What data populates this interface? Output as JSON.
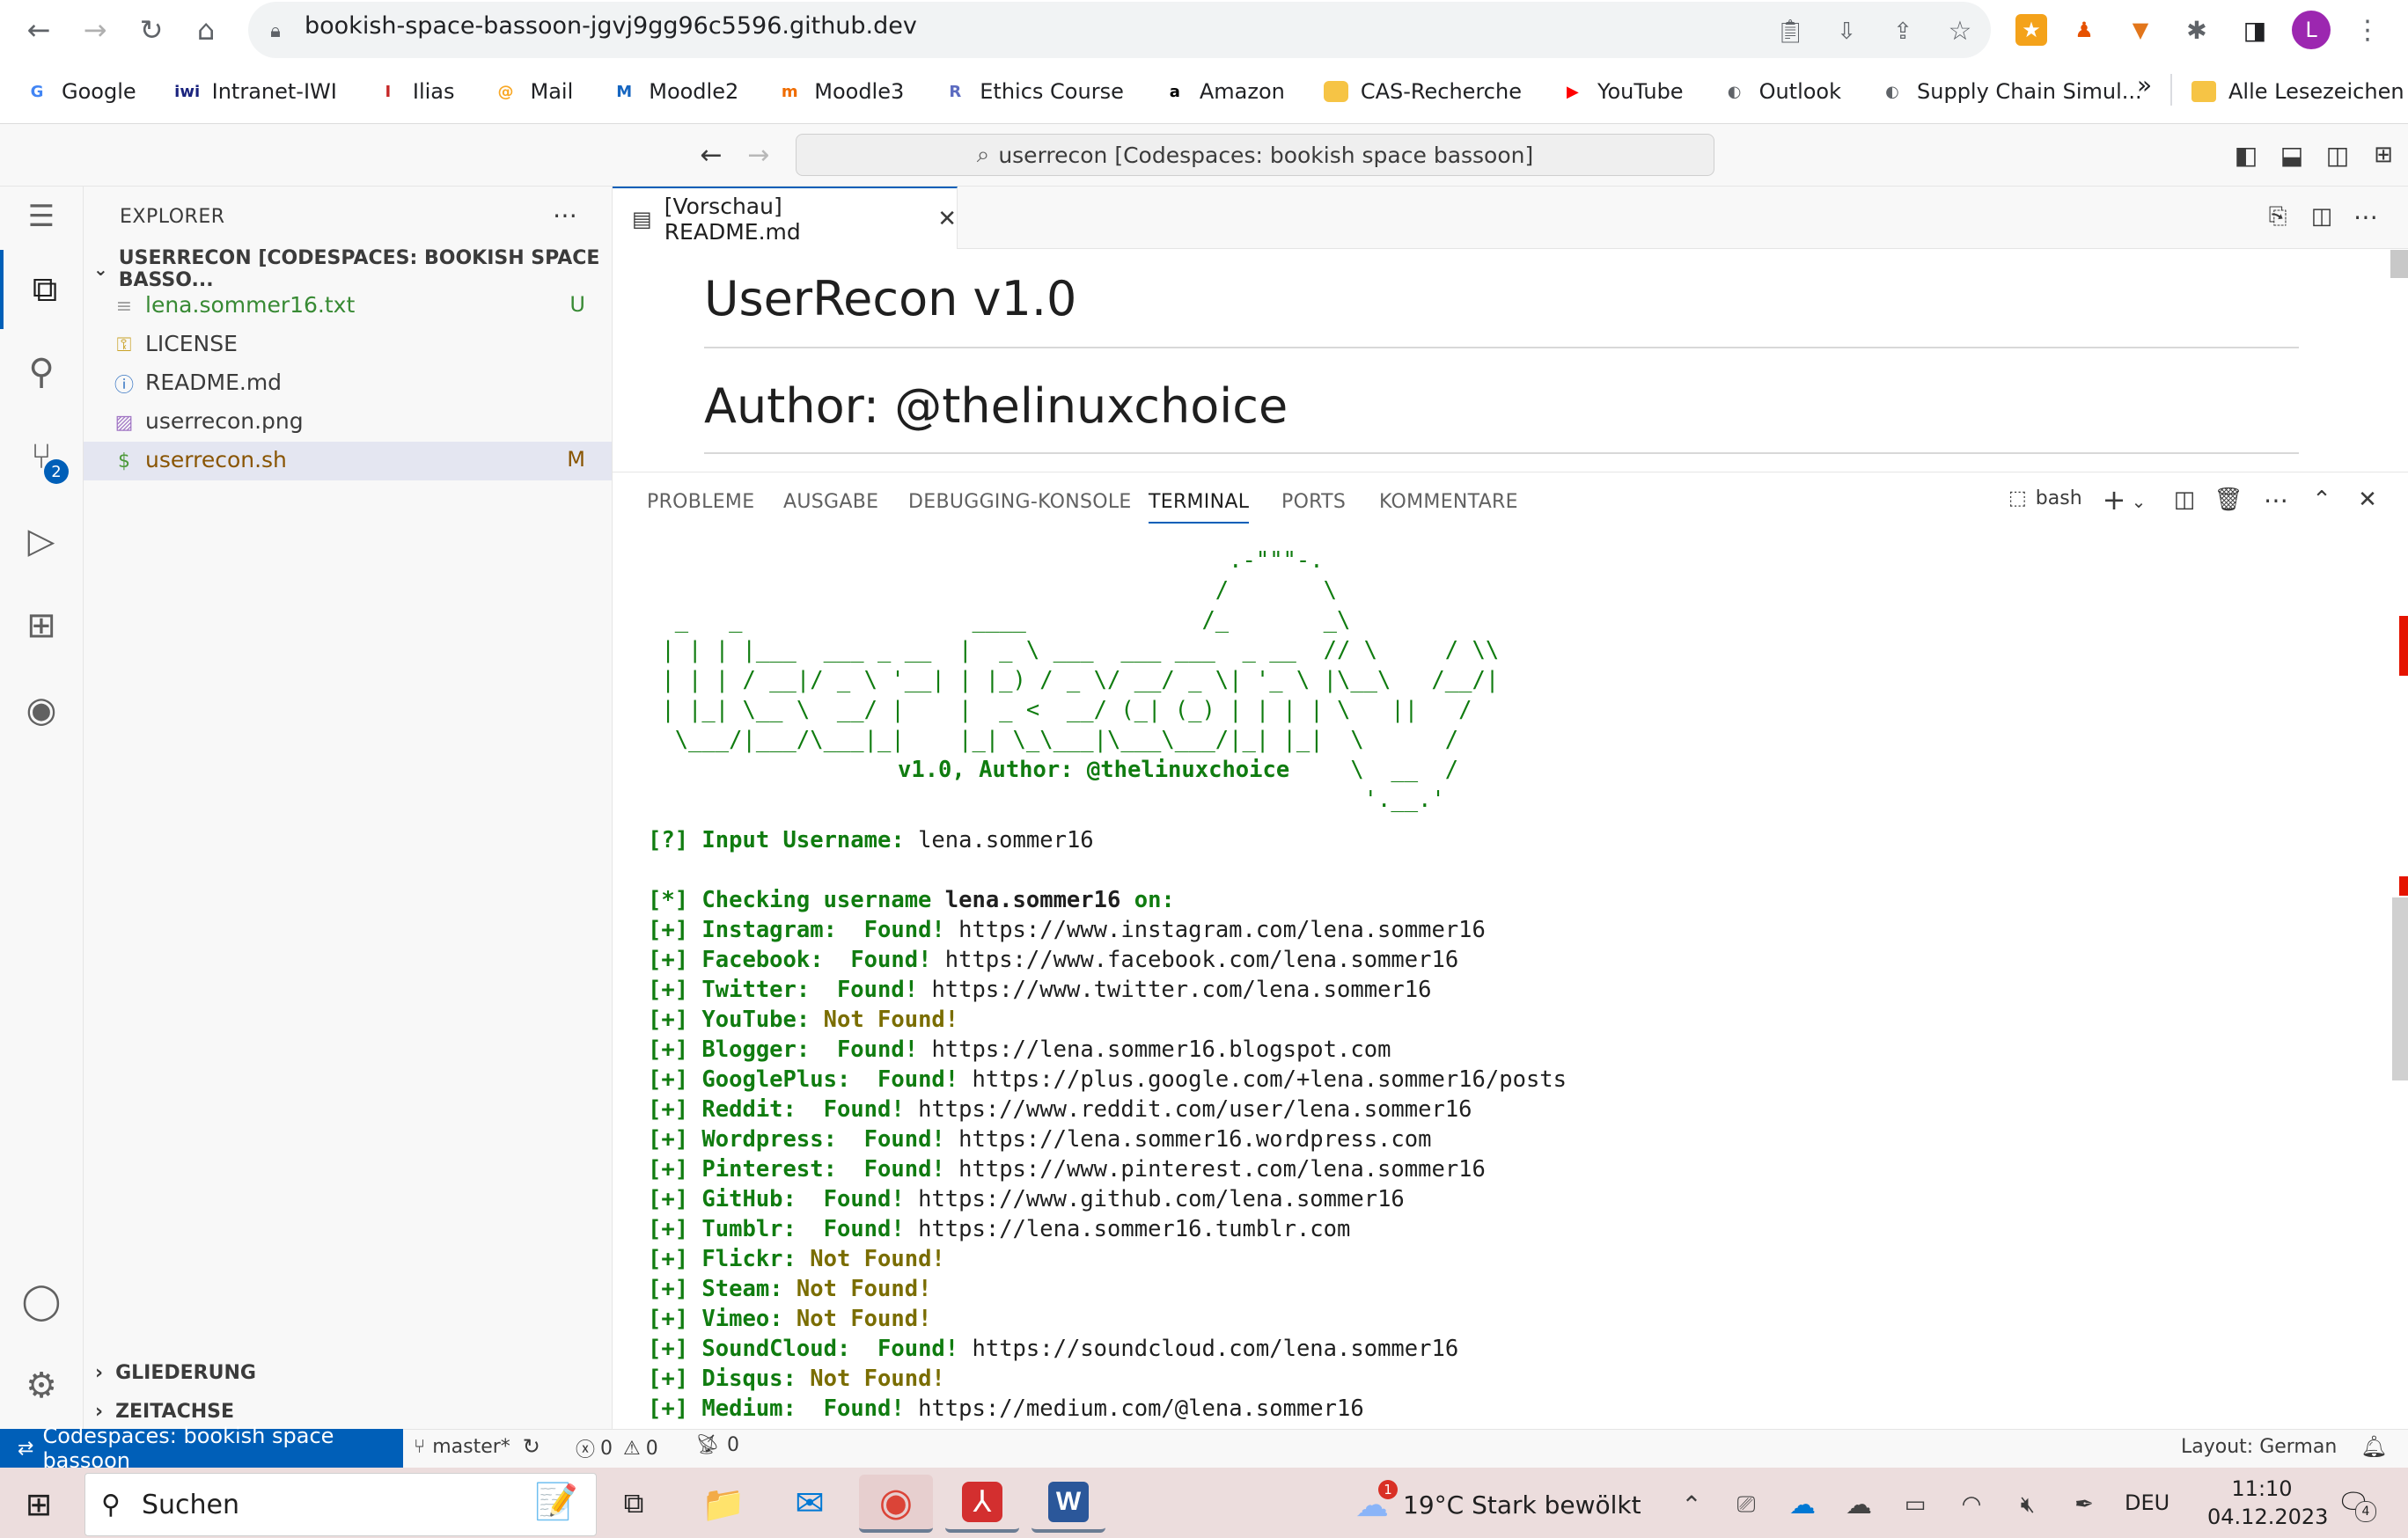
{
  "browser": {
    "url": "bookish-space-bassoon-jgvj9gg96c5596.github.dev",
    "profile_initial": "L",
    "bookmarks": [
      {
        "label": "Google",
        "color": "#4285f4",
        "glyph": "G"
      },
      {
        "label": "Intranet-IWI",
        "color": "#1a237e",
        "glyph": "iwi"
      },
      {
        "label": "Ilias",
        "color": "#c62828",
        "glyph": "I"
      },
      {
        "label": "Mail",
        "color": "#f9a825",
        "glyph": "@"
      },
      {
        "label": "Moodle2",
        "color": "#1565c0",
        "glyph": "M"
      },
      {
        "label": "Moodle3",
        "color": "#ef6c00",
        "glyph": "m"
      },
      {
        "label": "Ethics Course",
        "color": "#5c6bc0",
        "glyph": "R"
      },
      {
        "label": "Amazon",
        "color": "#000000",
        "glyph": "a"
      },
      {
        "label": "CAS-Recherche",
        "color": "#f6c445",
        "glyph": ""
      },
      {
        "label": "YouTube",
        "color": "#ff0000",
        "glyph": "▶"
      },
      {
        "label": "Outlook",
        "color": "#5f6368",
        "glyph": "◐"
      },
      {
        "label": "Supply Chain Simul...",
        "color": "#5f6368",
        "glyph": "◐"
      }
    ],
    "more_bookmarks": "»",
    "all_bookmarks": "Alle Lesezeichen"
  },
  "vscode": {
    "command_center": "userrecon [Codespaces: bookish space bassoon]",
    "scm_badge": "2",
    "explorer": {
      "title": "EXPLORER",
      "workspace": "USERRECON [CODESPACES: BOOKISH SPACE BASSO...",
      "files": [
        {
          "name": "lena.sommer16.txt",
          "status": "U",
          "icon": "≡",
          "color": "#388a34",
          "icon_color": "#9e9e9e"
        },
        {
          "name": "LICENSE",
          "status": "",
          "icon": "⚿",
          "color": "#3b3b3b",
          "icon_color": "#c9a227"
        },
        {
          "name": "README.md",
          "status": "",
          "icon": "ⓘ",
          "color": "#3b3b3b",
          "icon_color": "#3b78c4"
        },
        {
          "name": "userrecon.png",
          "status": "",
          "icon": "▨",
          "color": "#3b3b3b",
          "icon_color": "#a074c4"
        },
        {
          "name": "userrecon.sh",
          "status": "M",
          "icon": "$",
          "color": "#895503",
          "icon_color": "#4d9a3a"
        }
      ],
      "sections": [
        "GLIEDERUNG",
        "ZEITACHSE"
      ]
    },
    "editor": {
      "tab_label": "[Vorschau] README.md",
      "heading1": "UserRecon v1.0",
      "heading2": "Author: @thelinuxchoice"
    },
    "panel": {
      "tabs": [
        "PROBLEME",
        "AUSGABE",
        "DEBUGGING-KONSOLE",
        "TERMINAL",
        "PORTS",
        "KOMMENTARE"
      ],
      "active_tab": "TERMINAL",
      "shell": "bash"
    },
    "terminal": {
      "banner_credit": "v1.0, Author: @thelinuxchoice",
      "input_prompt": "[?] Input Username:",
      "input_value": "lena.sommer16",
      "checking_prefix": "[*] Checking username",
      "checking_user": "lena.sommer16",
      "checking_suffix": "on:",
      "results": [
        {
          "site": "Instagram",
          "found": true,
          "url": "https://www.instagram.com/lena.sommer16"
        },
        {
          "site": "Facebook",
          "found": true,
          "url": "https://www.facebook.com/lena.sommer16"
        },
        {
          "site": "Twitter",
          "found": true,
          "url": "https://www.twitter.com/lena.sommer16"
        },
        {
          "site": "YouTube",
          "found": false,
          "url": ""
        },
        {
          "site": "Blogger",
          "found": true,
          "url": "https://lena.sommer16.blogspot.com"
        },
        {
          "site": "GooglePlus",
          "found": true,
          "url": "https://plus.google.com/+lena.sommer16/posts"
        },
        {
          "site": "Reddit",
          "found": true,
          "url": "https://www.reddit.com/user/lena.sommer16"
        },
        {
          "site": "Wordpress",
          "found": true,
          "url": "https://lena.sommer16.wordpress.com"
        },
        {
          "site": "Pinterest",
          "found": true,
          "url": "https://www.pinterest.com/lena.sommer16"
        },
        {
          "site": "GitHub",
          "found": true,
          "url": "https://www.github.com/lena.sommer16"
        },
        {
          "site": "Tumblr",
          "found": true,
          "url": "https://lena.sommer16.tumblr.com"
        },
        {
          "site": "Flickr",
          "found": false,
          "url": ""
        },
        {
          "site": "Steam",
          "found": false,
          "url": ""
        },
        {
          "site": "Vimeo",
          "found": false,
          "url": ""
        },
        {
          "site": "SoundCloud",
          "found": true,
          "url": "https://soundcloud.com/lena.sommer16"
        },
        {
          "site": "Disqus",
          "found": false,
          "url": ""
        },
        {
          "site": "Medium",
          "found": true,
          "url": "https://medium.com/@lena.sommer16"
        }
      ],
      "found_label": "Found!",
      "not_found_label": "Not Found!"
    },
    "statusbar": {
      "remote": "Codespaces: bookish space bassoon",
      "branch": "master*",
      "errors": "0",
      "warnings": "0",
      "ports": "0",
      "layout": "Layout: German"
    }
  },
  "taskbar": {
    "search_placeholder": "Suchen",
    "weather_badge": "1",
    "weather": "19°C  Stark bewölkt",
    "language": "DEU",
    "time": "11:10",
    "date": "04.12.2023",
    "notification_count": "4"
  },
  "colors": {
    "accent": "#005fb8",
    "terminal_green": "#107c10",
    "terminal_yellow": "#7a6d00"
  }
}
